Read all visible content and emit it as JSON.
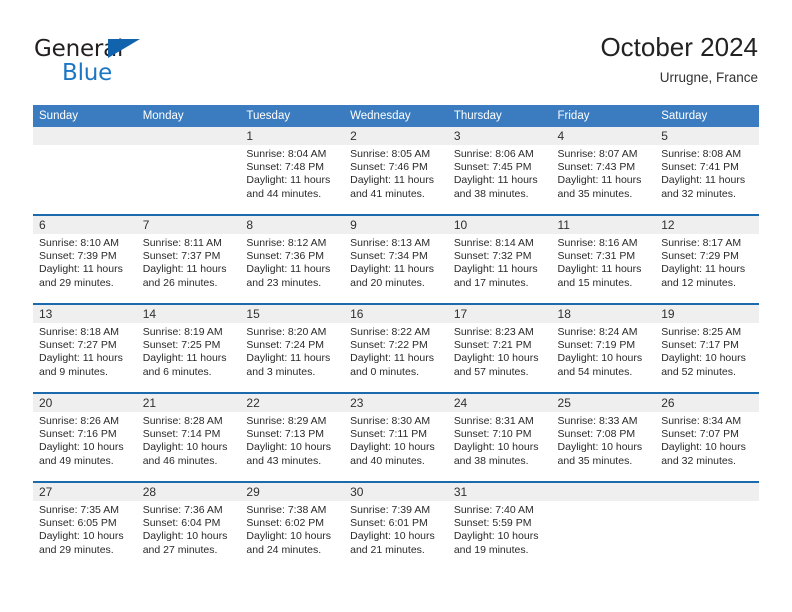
{
  "brand": {
    "word1": "General",
    "word2": "Blue",
    "triangle_color": "#1263ae",
    "blue_color": "#1b76c4"
  },
  "header": {
    "title": "October 2024",
    "subtitle": "Urrugne, France"
  },
  "theme": {
    "header_blue": "#3a7cbf",
    "separator_blue": "#1a6aad",
    "number_band_gray": "#efefef"
  },
  "calendar": {
    "weekday_headers": [
      "Sunday",
      "Monday",
      "Tuesday",
      "Wednesday",
      "Thursday",
      "Friday",
      "Saturday"
    ],
    "weeks": [
      [
        {
          "day": "",
          "sunrise": "",
          "sunset": "",
          "daylight_line1": "",
          "daylight_line2": ""
        },
        {
          "day": "",
          "sunrise": "",
          "sunset": "",
          "daylight_line1": "",
          "daylight_line2": ""
        },
        {
          "day": "1",
          "sunrise": "Sunrise: 8:04 AM",
          "sunset": "Sunset: 7:48 PM",
          "daylight_line1": "Daylight: 11 hours",
          "daylight_line2": "and 44 minutes."
        },
        {
          "day": "2",
          "sunrise": "Sunrise: 8:05 AM",
          "sunset": "Sunset: 7:46 PM",
          "daylight_line1": "Daylight: 11 hours",
          "daylight_line2": "and 41 minutes."
        },
        {
          "day": "3",
          "sunrise": "Sunrise: 8:06 AM",
          "sunset": "Sunset: 7:45 PM",
          "daylight_line1": "Daylight: 11 hours",
          "daylight_line2": "and 38 minutes."
        },
        {
          "day": "4",
          "sunrise": "Sunrise: 8:07 AM",
          "sunset": "Sunset: 7:43 PM",
          "daylight_line1": "Daylight: 11 hours",
          "daylight_line2": "and 35 minutes."
        },
        {
          "day": "5",
          "sunrise": "Sunrise: 8:08 AM",
          "sunset": "Sunset: 7:41 PM",
          "daylight_line1": "Daylight: 11 hours",
          "daylight_line2": "and 32 minutes."
        }
      ],
      [
        {
          "day": "6",
          "sunrise": "Sunrise: 8:10 AM",
          "sunset": "Sunset: 7:39 PM",
          "daylight_line1": "Daylight: 11 hours",
          "daylight_line2": "and 29 minutes."
        },
        {
          "day": "7",
          "sunrise": "Sunrise: 8:11 AM",
          "sunset": "Sunset: 7:37 PM",
          "daylight_line1": "Daylight: 11 hours",
          "daylight_line2": "and 26 minutes."
        },
        {
          "day": "8",
          "sunrise": "Sunrise: 8:12 AM",
          "sunset": "Sunset: 7:36 PM",
          "daylight_line1": "Daylight: 11 hours",
          "daylight_line2": "and 23 minutes."
        },
        {
          "day": "9",
          "sunrise": "Sunrise: 8:13 AM",
          "sunset": "Sunset: 7:34 PM",
          "daylight_line1": "Daylight: 11 hours",
          "daylight_line2": "and 20 minutes."
        },
        {
          "day": "10",
          "sunrise": "Sunrise: 8:14 AM",
          "sunset": "Sunset: 7:32 PM",
          "daylight_line1": "Daylight: 11 hours",
          "daylight_line2": "and 17 minutes."
        },
        {
          "day": "11",
          "sunrise": "Sunrise: 8:16 AM",
          "sunset": "Sunset: 7:31 PM",
          "daylight_line1": "Daylight: 11 hours",
          "daylight_line2": "and 15 minutes."
        },
        {
          "day": "12",
          "sunrise": "Sunrise: 8:17 AM",
          "sunset": "Sunset: 7:29 PM",
          "daylight_line1": "Daylight: 11 hours",
          "daylight_line2": "and 12 minutes."
        }
      ],
      [
        {
          "day": "13",
          "sunrise": "Sunrise: 8:18 AM",
          "sunset": "Sunset: 7:27 PM",
          "daylight_line1": "Daylight: 11 hours",
          "daylight_line2": "and 9 minutes."
        },
        {
          "day": "14",
          "sunrise": "Sunrise: 8:19 AM",
          "sunset": "Sunset: 7:25 PM",
          "daylight_line1": "Daylight: 11 hours",
          "daylight_line2": "and 6 minutes."
        },
        {
          "day": "15",
          "sunrise": "Sunrise: 8:20 AM",
          "sunset": "Sunset: 7:24 PM",
          "daylight_line1": "Daylight: 11 hours",
          "daylight_line2": "and 3 minutes."
        },
        {
          "day": "16",
          "sunrise": "Sunrise: 8:22 AM",
          "sunset": "Sunset: 7:22 PM",
          "daylight_line1": "Daylight: 11 hours",
          "daylight_line2": "and 0 minutes."
        },
        {
          "day": "17",
          "sunrise": "Sunrise: 8:23 AM",
          "sunset": "Sunset: 7:21 PM",
          "daylight_line1": "Daylight: 10 hours",
          "daylight_line2": "and 57 minutes."
        },
        {
          "day": "18",
          "sunrise": "Sunrise: 8:24 AM",
          "sunset": "Sunset: 7:19 PM",
          "daylight_line1": "Daylight: 10 hours",
          "daylight_line2": "and 54 minutes."
        },
        {
          "day": "19",
          "sunrise": "Sunrise: 8:25 AM",
          "sunset": "Sunset: 7:17 PM",
          "daylight_line1": "Daylight: 10 hours",
          "daylight_line2": "and 52 minutes."
        }
      ],
      [
        {
          "day": "20",
          "sunrise": "Sunrise: 8:26 AM",
          "sunset": "Sunset: 7:16 PM",
          "daylight_line1": "Daylight: 10 hours",
          "daylight_line2": "and 49 minutes."
        },
        {
          "day": "21",
          "sunrise": "Sunrise: 8:28 AM",
          "sunset": "Sunset: 7:14 PM",
          "daylight_line1": "Daylight: 10 hours",
          "daylight_line2": "and 46 minutes."
        },
        {
          "day": "22",
          "sunrise": "Sunrise: 8:29 AM",
          "sunset": "Sunset: 7:13 PM",
          "daylight_line1": "Daylight: 10 hours",
          "daylight_line2": "and 43 minutes."
        },
        {
          "day": "23",
          "sunrise": "Sunrise: 8:30 AM",
          "sunset": "Sunset: 7:11 PM",
          "daylight_line1": "Daylight: 10 hours",
          "daylight_line2": "and 40 minutes."
        },
        {
          "day": "24",
          "sunrise": "Sunrise: 8:31 AM",
          "sunset": "Sunset: 7:10 PM",
          "daylight_line1": "Daylight: 10 hours",
          "daylight_line2": "and 38 minutes."
        },
        {
          "day": "25",
          "sunrise": "Sunrise: 8:33 AM",
          "sunset": "Sunset: 7:08 PM",
          "daylight_line1": "Daylight: 10 hours",
          "daylight_line2": "and 35 minutes."
        },
        {
          "day": "26",
          "sunrise": "Sunrise: 8:34 AM",
          "sunset": "Sunset: 7:07 PM",
          "daylight_line1": "Daylight: 10 hours",
          "daylight_line2": "and 32 minutes."
        }
      ],
      [
        {
          "day": "27",
          "sunrise": "Sunrise: 7:35 AM",
          "sunset": "Sunset: 6:05 PM",
          "daylight_line1": "Daylight: 10 hours",
          "daylight_line2": "and 29 minutes."
        },
        {
          "day": "28",
          "sunrise": "Sunrise: 7:36 AM",
          "sunset": "Sunset: 6:04 PM",
          "daylight_line1": "Daylight: 10 hours",
          "daylight_line2": "and 27 minutes."
        },
        {
          "day": "29",
          "sunrise": "Sunrise: 7:38 AM",
          "sunset": "Sunset: 6:02 PM",
          "daylight_line1": "Daylight: 10 hours",
          "daylight_line2": "and 24 minutes."
        },
        {
          "day": "30",
          "sunrise": "Sunrise: 7:39 AM",
          "sunset": "Sunset: 6:01 PM",
          "daylight_line1": "Daylight: 10 hours",
          "daylight_line2": "and 21 minutes."
        },
        {
          "day": "31",
          "sunrise": "Sunrise: 7:40 AM",
          "sunset": "Sunset: 5:59 PM",
          "daylight_line1": "Daylight: 10 hours",
          "daylight_line2": "and 19 minutes."
        },
        {
          "day": "",
          "sunrise": "",
          "sunset": "",
          "daylight_line1": "",
          "daylight_line2": ""
        },
        {
          "day": "",
          "sunrise": "",
          "sunset": "",
          "daylight_line1": "",
          "daylight_line2": ""
        }
      ]
    ]
  }
}
